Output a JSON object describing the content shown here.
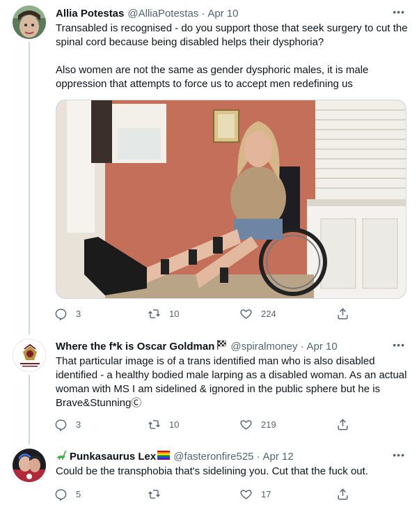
{
  "tweets": [
    {
      "name": "Allia Potestas",
      "handle": "@AlliaPotestas",
      "date": "Apr 10",
      "body": [
        "Transabled is recognised - do you support those that seek surgery to cut the spinal cord because being disabled helps their dysphoria?",
        "Also women are not the same as gender dysphoric males, it is male oppression that attempts to force us to accept men redefining us"
      ],
      "reply_count": "3",
      "retweet_count": "10",
      "like_count": "224"
    },
    {
      "name": "Where the f*k is Oscar Goldman",
      "handle": "@spiralmoney",
      "date": "Apr 10",
      "body": "That particular image is of a trans identified man who is also disabled identified - a healthy bodied male larping as a disabled woman. As an actual woman with MS I am sidelined & ignored in the public sphere but he is Brave&StunningⒸ",
      "reply_count": "3",
      "retweet_count": "10",
      "like_count": "219"
    },
    {
      "name": "Punkasaurus Lex",
      "handle": "@fasteronfire525",
      "date": "Apr 12",
      "body": "Could be the transphobia that's sidelining you. Cut that the fuck out.",
      "reply_count": "5",
      "retweet_count": "",
      "like_count": "17"
    }
  ],
  "ui": {
    "more_label": "•••",
    "separator": "·"
  },
  "icons": {
    "reply": "reply-icon",
    "retweet": "retweet-icon",
    "like": "like-icon",
    "share": "share-icon",
    "more": "more-icon",
    "flag": "checkered-flag-icon",
    "dino": "sauropod-icon",
    "rainbow": "rainbow-flag-icon"
  },
  "colors": {
    "text": "#0f1419",
    "secondary": "#536471",
    "thread_line": "#cfd9de"
  }
}
